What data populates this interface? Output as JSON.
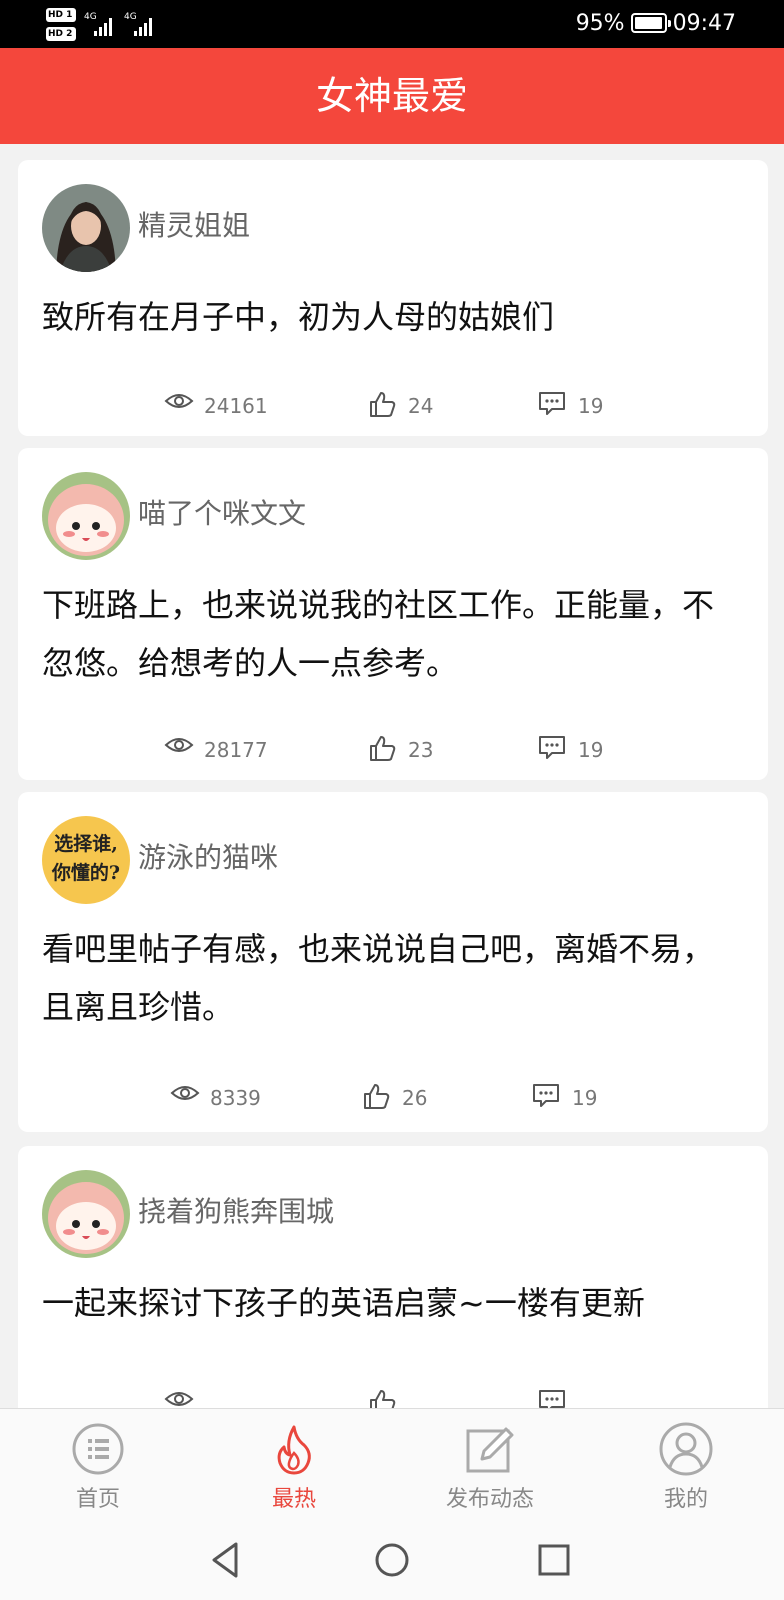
{
  "status_bar": {
    "hd1": "HD 1",
    "hd2": "HD 2",
    "net1": "4G",
    "net2": "4G",
    "battery_pct": "95%",
    "time": "09:47"
  },
  "header": {
    "title": "女神最爱"
  },
  "posts": [
    {
      "author": "精灵姐姐",
      "content": "致所有在月子中，初为人母的姑娘们",
      "views": "24161",
      "likes": "24",
      "comments": "19"
    },
    {
      "author": "喵了个咪文文",
      "content": "下班路上，也来说说我的社区工作。正能量，不忽悠。给想考的人一点参考。",
      "views": "28177",
      "likes": "23",
      "comments": "19"
    },
    {
      "author": "游泳的猫咪",
      "avatar_text": "选择谁,你懂的?",
      "content": "看吧里帖子有感，也来说说自己吧，离婚不易，且离且珍惜。",
      "views": "8339",
      "likes": "26",
      "comments": "19"
    },
    {
      "author": "挠着狗熊奔围城",
      "content": "一起来探讨下孩子的英语启蒙~一楼有更新"
    }
  ],
  "tabs": [
    {
      "label": "首页",
      "icon": "list-refresh-icon"
    },
    {
      "label": "最热",
      "icon": "flame-icon",
      "active": true
    },
    {
      "label": "发布动态",
      "icon": "edit-icon"
    },
    {
      "label": "我的",
      "icon": "user-icon"
    }
  ],
  "colors": {
    "accent": "#f4473c",
    "active_tab": "#e9473d"
  }
}
